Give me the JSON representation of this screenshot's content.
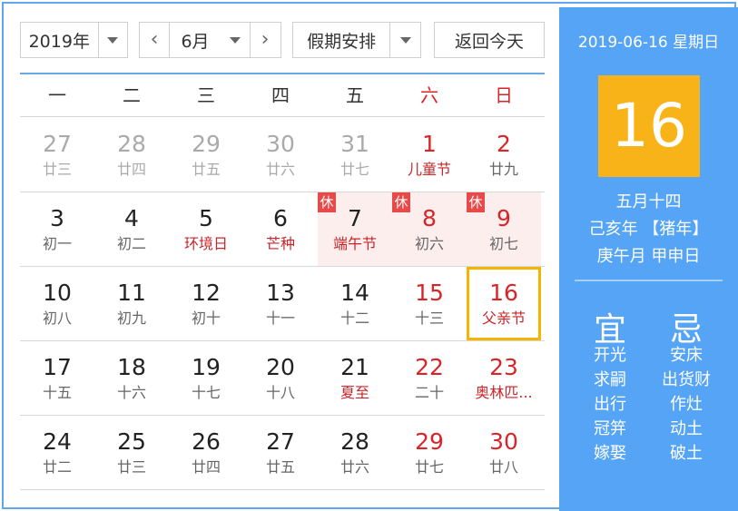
{
  "toolbar": {
    "year": "2019年",
    "month": "6月",
    "prev_symbol": "‹",
    "next_symbol": "›",
    "holiday": "假期安排",
    "today_button": "返回今天"
  },
  "weekdays": [
    "一",
    "二",
    "三",
    "四",
    "五",
    "六",
    "日"
  ],
  "weeks": [
    [
      {
        "day": "27",
        "sub": "廿三",
        "other": true
      },
      {
        "day": "28",
        "sub": "廿四",
        "other": true
      },
      {
        "day": "29",
        "sub": "廿五",
        "other": true
      },
      {
        "day": "30",
        "sub": "廿六",
        "other": true
      },
      {
        "day": "31",
        "sub": "廿七",
        "other": true
      },
      {
        "day": "1",
        "sub": "儿童节",
        "red_day": true,
        "red_sub": true
      },
      {
        "day": "2",
        "sub": "廿九",
        "red_day": true
      }
    ],
    [
      {
        "day": "3",
        "sub": "初一"
      },
      {
        "day": "4",
        "sub": "初二"
      },
      {
        "day": "5",
        "sub": "环境日",
        "red_sub": true
      },
      {
        "day": "6",
        "sub": "芒种",
        "red_sub": true
      },
      {
        "day": "7",
        "sub": "端午节",
        "red_sub": true,
        "rest": true
      },
      {
        "day": "8",
        "sub": "初六",
        "red_day": true,
        "rest": true
      },
      {
        "day": "9",
        "sub": "初七",
        "red_day": true,
        "rest": true
      }
    ],
    [
      {
        "day": "10",
        "sub": "初八"
      },
      {
        "day": "11",
        "sub": "初九"
      },
      {
        "day": "12",
        "sub": "初十"
      },
      {
        "day": "13",
        "sub": "十一"
      },
      {
        "day": "14",
        "sub": "十二"
      },
      {
        "day": "15",
        "sub": "十三",
        "red_day": true
      },
      {
        "day": "16",
        "sub": "父亲节",
        "red_day": true,
        "red_sub": true,
        "today": true
      }
    ],
    [
      {
        "day": "17",
        "sub": "十五"
      },
      {
        "day": "18",
        "sub": "十六"
      },
      {
        "day": "19",
        "sub": "十七"
      },
      {
        "day": "20",
        "sub": "十八"
      },
      {
        "day": "21",
        "sub": "夏至",
        "red_sub": true
      },
      {
        "day": "22",
        "sub": "二十",
        "red_day": true
      },
      {
        "day": "23",
        "sub": "奥林匹...",
        "red_day": true,
        "red_sub": true
      }
    ],
    [
      {
        "day": "24",
        "sub": "廿二"
      },
      {
        "day": "25",
        "sub": "廿三"
      },
      {
        "day": "26",
        "sub": "廿四"
      },
      {
        "day": "27",
        "sub": "廿五"
      },
      {
        "day": "28",
        "sub": "廿六"
      },
      {
        "day": "29",
        "sub": "廿七",
        "red_day": true
      },
      {
        "day": "30",
        "sub": "廿八",
        "red_day": true
      }
    ]
  ],
  "rest_badge": "休",
  "side": {
    "date_line": "2019-06-16 星期日",
    "big_day": "16",
    "lunar_lines": [
      "五月十四",
      "己亥年 【猪年】",
      "庚午月 甲申日"
    ],
    "yi_title": "宜",
    "ji_title": "忌",
    "yi_items": [
      "开光",
      "求嗣",
      "出行",
      "冠笄",
      "嫁娶"
    ],
    "ji_items": [
      "安床",
      "出货财",
      "作灶",
      "动土",
      "破土"
    ]
  },
  "colors": {
    "accent_blue": "#55a4f5",
    "highlight_yellow": "#f7b317",
    "holiday_red": "#d8252a",
    "rest_bg": "#fdeeee"
  }
}
